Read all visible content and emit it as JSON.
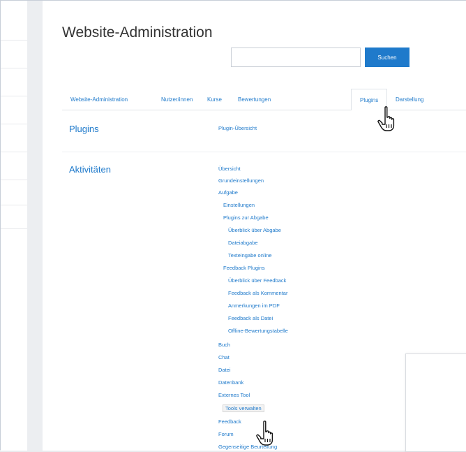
{
  "page_title": "Website-Administration",
  "search": {
    "placeholder": "",
    "button_label": "Suchen"
  },
  "tabs": [
    {
      "label": "Website-Administration"
    },
    {
      "label": "Nutzer/innen"
    },
    {
      "label": "Kurse"
    },
    {
      "label": "Bewertungen"
    },
    {
      "label": "Plugins",
      "active": true
    },
    {
      "label": "Darstellung"
    }
  ],
  "plugins_section": {
    "label": "Plugins",
    "links": [
      "Plugin-Übersicht"
    ]
  },
  "activities_section": {
    "label": "Aktivitäten",
    "items": [
      "Übersicht",
      "Grundeinstellungen",
      "Aufgabe",
      "Einstellungen",
      "Plugins zur Abgabe",
      "Überblick über Abgabe",
      "Dateiabgabe",
      "Texteingabe online",
      "Feedback Plugins",
      "Überblick über Feedback",
      "Feedback als Kommentar",
      "Anmerkungen im PDF",
      "Feedback als Datei",
      "Offline-Bewertungstabelle",
      "Buch",
      "Chat",
      "Datei",
      "Datenbank",
      "Externes Tool",
      "Tools verwalten",
      "Feedback",
      "Forum",
      "Gegenseitige Beurteilung"
    ]
  },
  "icons": {
    "cursor": "hand-pointer-icon"
  },
  "colors": {
    "link": "#1f7acb",
    "button": "#1f7acb"
  }
}
